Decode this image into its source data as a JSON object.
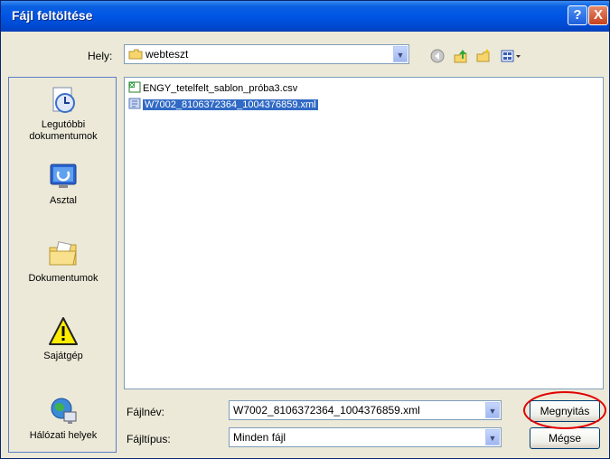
{
  "window": {
    "title": "Fájl feltöltése",
    "help_glyph": "?",
    "close_glyph": "X"
  },
  "location": {
    "label": "Hely:",
    "value": "webteszt",
    "dropdown_glyph": "▼"
  },
  "toolbar": {
    "back_icon": "back-icon",
    "up_folder_icon": "up-folder-icon",
    "new_folder_icon": "new-folder-icon",
    "views_icon": "views-icon"
  },
  "places": [
    {
      "label": "Legutóbbi dokumentumok",
      "icon": "recent-documents-icon"
    },
    {
      "label": "Asztal",
      "icon": "desktop-icon"
    },
    {
      "label": "Dokumentumok",
      "icon": "my-documents-icon"
    },
    {
      "label": "Sajátgép",
      "icon": "my-computer-icon"
    },
    {
      "label": "Hálózati helyek",
      "icon": "network-places-icon"
    }
  ],
  "files": [
    {
      "name": "ENGY_tetelfelt_sablon_próba3.csv",
      "icon": "csv-file-icon",
      "selected": false
    },
    {
      "name": "W7002_8106372364_1004376859.xml",
      "icon": "xml-file-icon",
      "selected": true
    }
  ],
  "filename": {
    "label": "Fájlnév:",
    "value": "W7002_8106372364_1004376859.xml"
  },
  "filetype": {
    "label": "Fájltípus:",
    "value": "Minden fájl"
  },
  "buttons": {
    "open": "Megnyitás",
    "cancel": "Mégse"
  },
  "colors": {
    "titlebar": "#0055e5",
    "selection": "#316ac5",
    "highlight_ring": "#e00000"
  }
}
